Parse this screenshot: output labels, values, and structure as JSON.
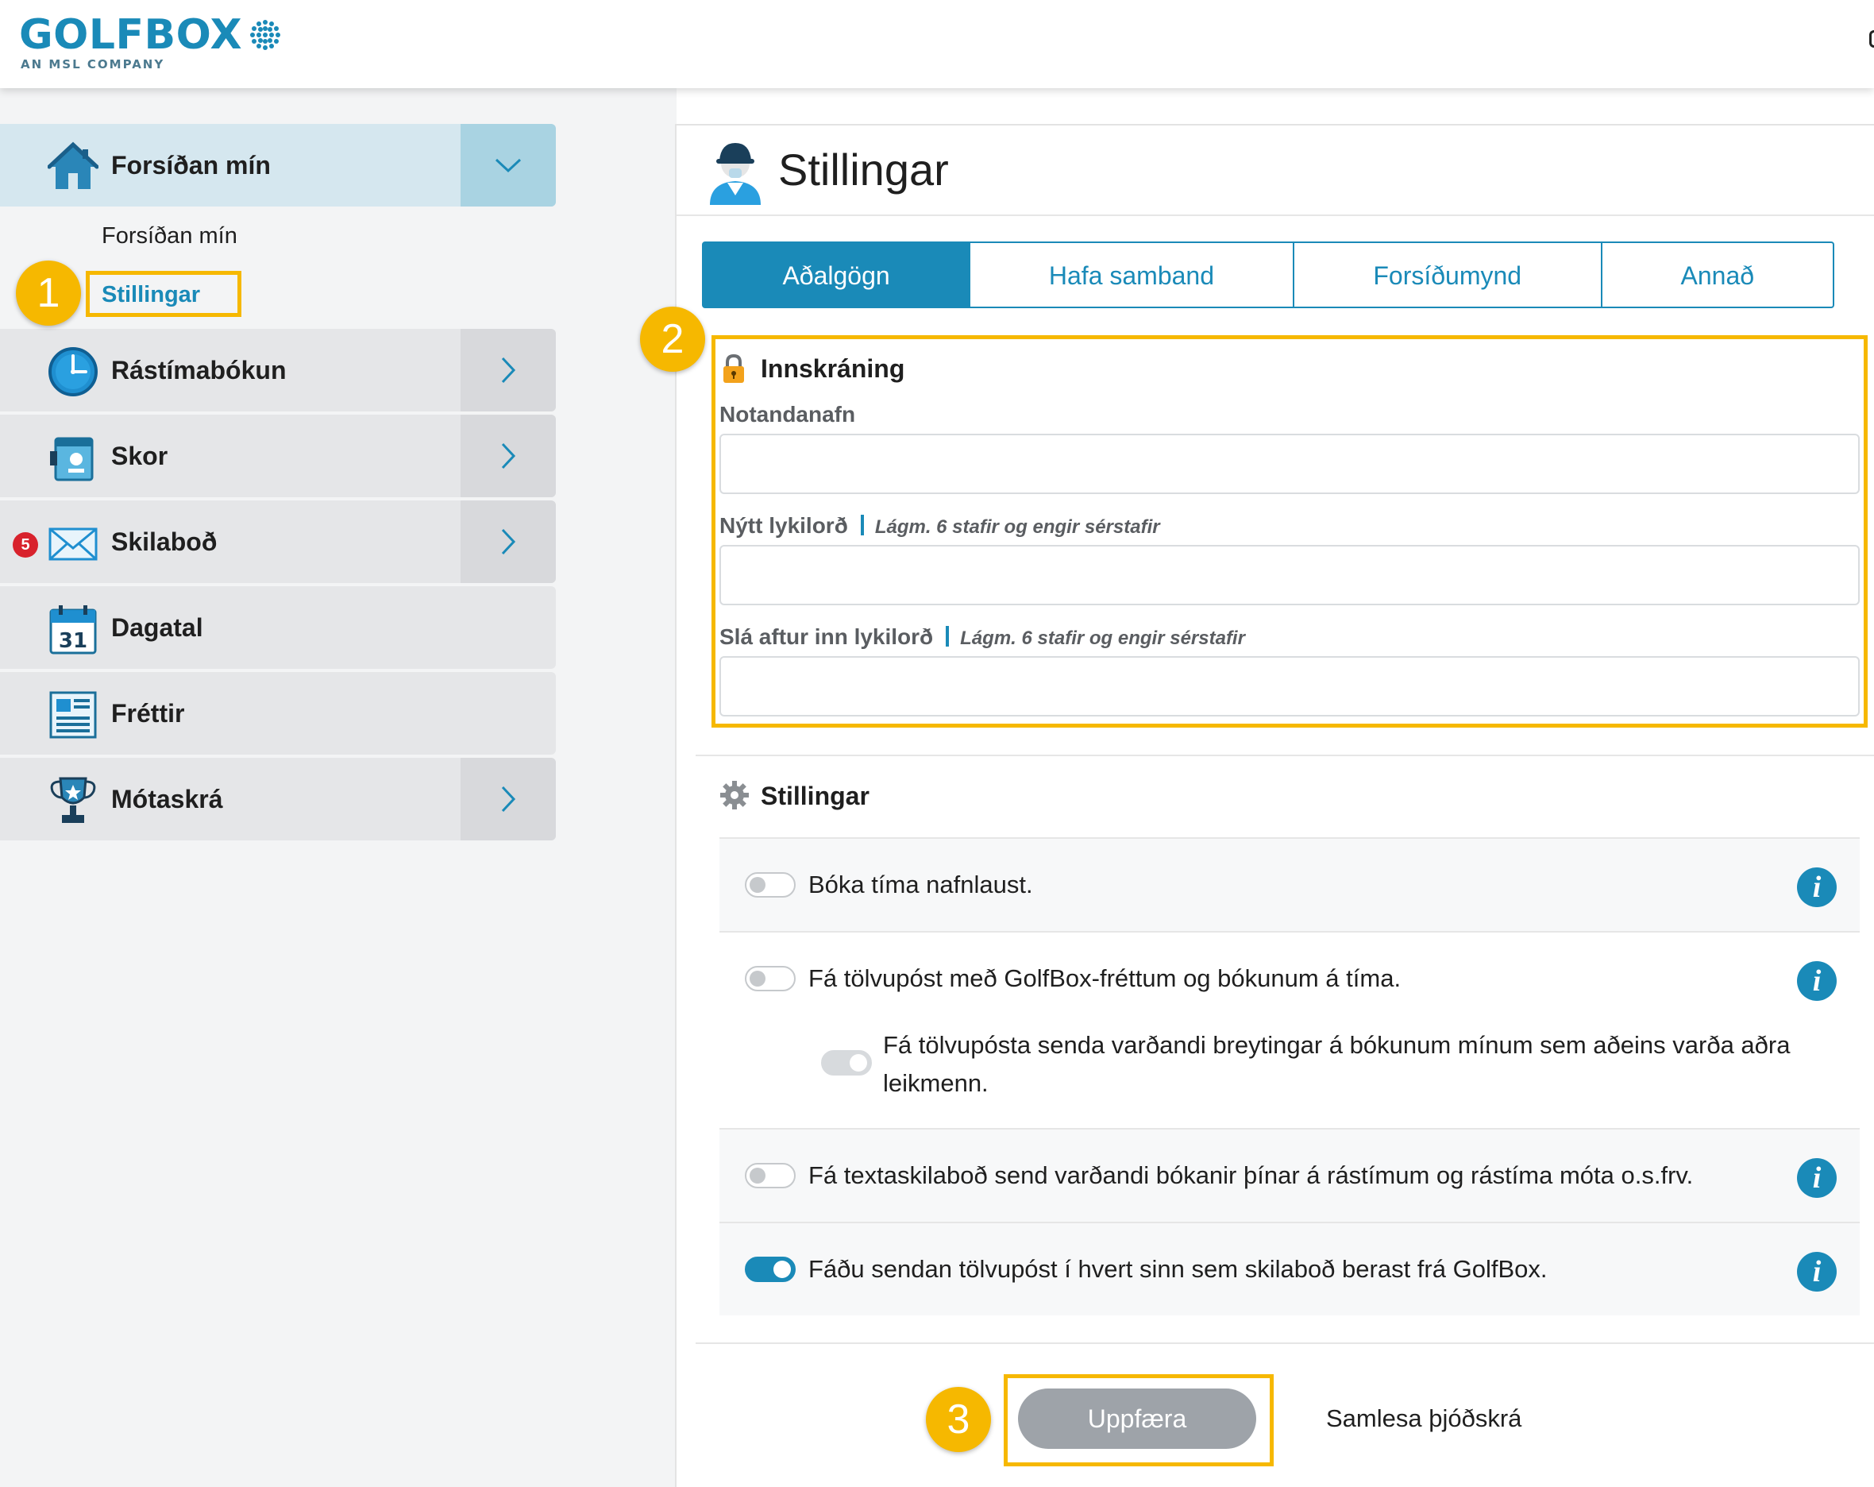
{
  "header": {
    "logo_text": "GOLFBOX",
    "logo_subtitle": "AN MSL COMPANY"
  },
  "sidebar": {
    "main_item": {
      "label": "Forsíðan mín",
      "icon": "home-icon"
    },
    "sub_items": [
      {
        "label": "Forsíðan mín",
        "active": false
      },
      {
        "label": "Stillingar",
        "active": true
      }
    ],
    "items": [
      {
        "label": "Rástímabókun",
        "icon": "clock-icon",
        "has_arrow": true
      },
      {
        "label": "Skor",
        "icon": "scorecard-icon",
        "has_arrow": true
      },
      {
        "label": "Skilaboð",
        "icon": "envelope-icon",
        "has_arrow": true,
        "badge": "5"
      },
      {
        "label": "Dagatal",
        "icon": "calendar-icon",
        "has_arrow": false,
        "icon_text": "31"
      },
      {
        "label": "Fréttir",
        "icon": "newspaper-icon",
        "has_arrow": false
      },
      {
        "label": "Mótaskrá",
        "icon": "trophy-icon",
        "has_arrow": true
      }
    ]
  },
  "page": {
    "title": "Stillingar",
    "tabs": [
      "Aðalgögn",
      "Hafa samband",
      "Forsíðumynd",
      "Annað"
    ],
    "active_tab": "Aðalgögn"
  },
  "login_section": {
    "title": "Innskráning",
    "username_label": "Notandanafn",
    "username_value": "",
    "new_password_label": "Nýtt lykilorð",
    "new_password_hint": "Lágm. 6 stafir og engir sérstafir",
    "new_password_value": "",
    "repeat_password_label": "Slá aftur inn lykilorð",
    "repeat_password_hint": "Lágm. 6 stafir og engir sérstafir",
    "repeat_password_value": ""
  },
  "settings_section": {
    "title": "Stillingar",
    "options": [
      {
        "text": "Bóka tíma nafnlaust.",
        "enabled": false
      },
      {
        "text": "Fá tölvupóst með GolfBox-fréttum og bókunum á tíma.",
        "enabled": false
      },
      {
        "text": "Fá tölvupósta senda varðandi breytingar á bókunum mínum sem aðeins varða aðra leikmenn.",
        "enabled": false,
        "sub_option": true,
        "disabled": true
      },
      {
        "text": "Fá textaskilaboð send varðandi bókanir þínar á rástímum og rástíma móta o.s.frv.",
        "enabled": false
      },
      {
        "text": "Fáðu sendan tölvupóst í hvert sinn sem skilaboð berast frá GolfBox.",
        "enabled": true
      }
    ],
    "info_glyph": "i"
  },
  "actions": {
    "update_label": "Uppfæra",
    "samlesa_label": "Samlesa þjóðskrá"
  },
  "annotations": [
    "1",
    "2",
    "3"
  ],
  "colors": {
    "accent": "#1a8ab8",
    "highlight": "#f6b800",
    "badge": "#d8222c",
    "button_disabled": "#9ea3a9"
  }
}
